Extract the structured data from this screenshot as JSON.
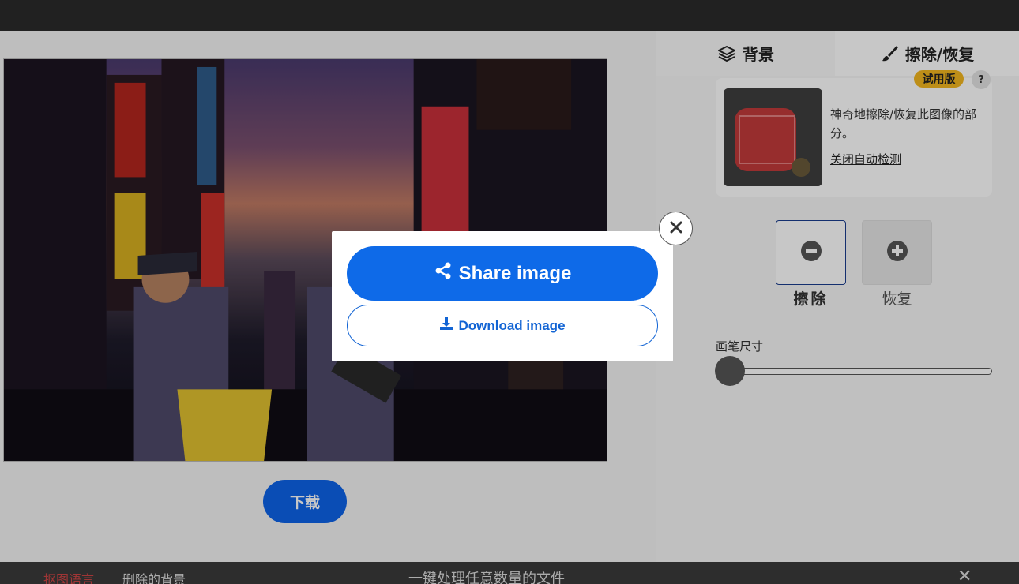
{
  "tabs": {
    "background_label": "背景",
    "erase_restore_label": "擦除/恢复"
  },
  "canvas": {
    "download_label": "下载"
  },
  "side_panel": {
    "trial_badge": "试用版",
    "help_label": "?",
    "promo_text": "神奇地擦除/恢复此图像的部分。",
    "promo_link": "关闭自动检测",
    "erase_label": "擦除",
    "restore_label": "恢复",
    "brush_size_label": "画笔尺寸",
    "brush_size_level": 0.0
  },
  "bottom_bar": {
    "badge_text": "抠图语言",
    "text1": "删除的背景",
    "text2": "一键处理任意数量的文件",
    "close_icon": "close-icon"
  },
  "modal": {
    "share_label": "Share image",
    "download_label": "Download image",
    "share_icon": "share-icon",
    "download_icon": "download-icon",
    "close_icon": "close-icon"
  },
  "colors": {
    "primary": "#0e6ae8",
    "trial_badge": "#f3b61f",
    "erase_border": "#1a3d8f"
  }
}
